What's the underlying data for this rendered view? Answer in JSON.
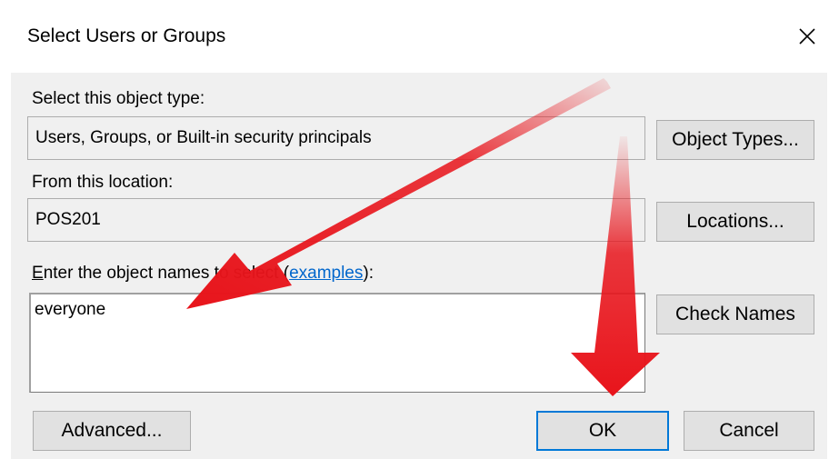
{
  "dialog": {
    "title": "Select Users or Groups",
    "close_icon": "close-icon"
  },
  "object_type": {
    "label": "Select this object type:",
    "value": "Users, Groups, or Built-in security principals",
    "button": "Object Types..."
  },
  "location": {
    "label": "From this location:",
    "value": "POS201",
    "button": "Locations..."
  },
  "names": {
    "label_first": "E",
    "label_rest": "nter the object names to select (",
    "link": "examples",
    "label_end": "):",
    "value": "everyone",
    "button": "Check Names"
  },
  "footer": {
    "advanced": "Advanced...",
    "ok": "OK",
    "cancel": "Cancel"
  },
  "annotation": {
    "arrow_color": "#e8141b",
    "arrows": [
      "arrow-to-names-field",
      "arrow-to-ok-button"
    ]
  }
}
